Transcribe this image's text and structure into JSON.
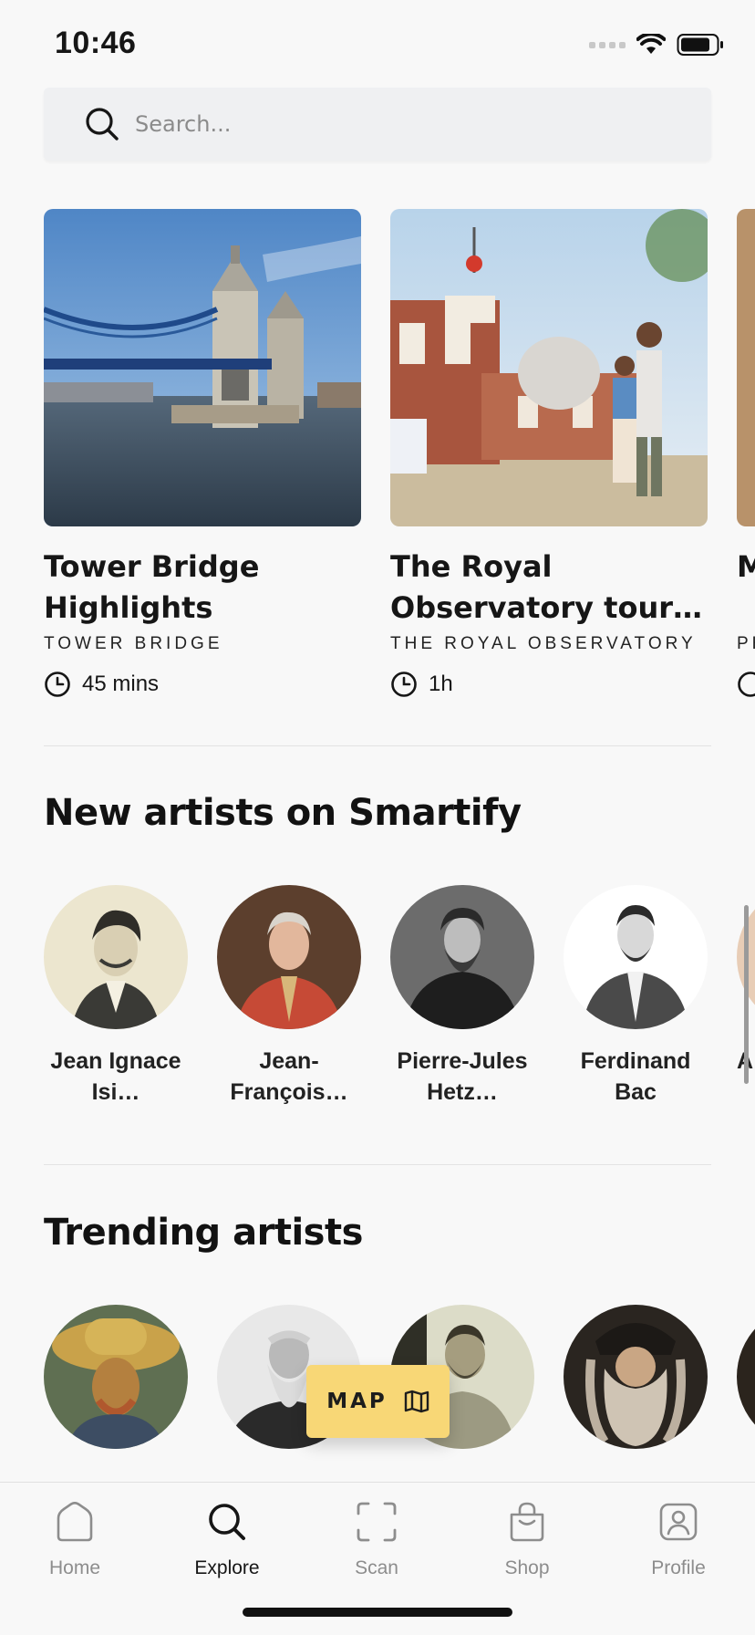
{
  "status_bar": {
    "time": "10:46"
  },
  "search": {
    "placeholder": "Search..."
  },
  "tours": [
    {
      "title": "Tower Bridge Highlights",
      "venue": "TOWER BRIDGE",
      "duration": "45 mins",
      "image": "tower-bridge-photo"
    },
    {
      "title": "The Royal Observatory tour wi…",
      "venue": "THE ROYAL OBSERVATORY",
      "duration": "1h",
      "image": "royal-observatory-photo"
    },
    {
      "title": "M W",
      "venue": "PH",
      "duration": "",
      "image": "partial-card-photo"
    }
  ],
  "new_artists": {
    "title": "New artists on Smartify",
    "items": [
      {
        "name": "Jean Ignace Isi…",
        "portrait": "engraved-portrait"
      },
      {
        "name": "Jean-François…",
        "portrait": "painted-portrait-red-coat"
      },
      {
        "name": "Pierre-Jules Hetz…",
        "portrait": "photo-portrait-bearded"
      },
      {
        "name": "Ferdinand Bac",
        "portrait": "engraved-portrait-mustache"
      },
      {
        "name": "A",
        "portrait": "partial-portrait"
      }
    ]
  },
  "trending_artists": {
    "title": "Trending artists",
    "items": [
      {
        "portrait": "van-gogh-self-portrait"
      },
      {
        "portrait": "monet-photo"
      },
      {
        "portrait": "klimt-photo"
      },
      {
        "portrait": "da-vinci-portrait"
      },
      {
        "portrait": "partial-portrait"
      }
    ]
  },
  "map_button": {
    "label": "MAP",
    "icon": "map-icon"
  },
  "tab_bar": [
    {
      "label": "Home",
      "icon": "home-icon",
      "active": false
    },
    {
      "label": "Explore",
      "icon": "search-icon",
      "active": true
    },
    {
      "label": "Scan",
      "icon": "scan-icon",
      "active": false
    },
    {
      "label": "Shop",
      "icon": "shopping-bag-icon",
      "active": false
    },
    {
      "label": "Profile",
      "icon": "profile-icon",
      "active": false
    }
  ],
  "colors": {
    "accent_yellow": "#f8d776",
    "background": "#f8f8f8",
    "inactive_tab": "#8d8d8d"
  }
}
